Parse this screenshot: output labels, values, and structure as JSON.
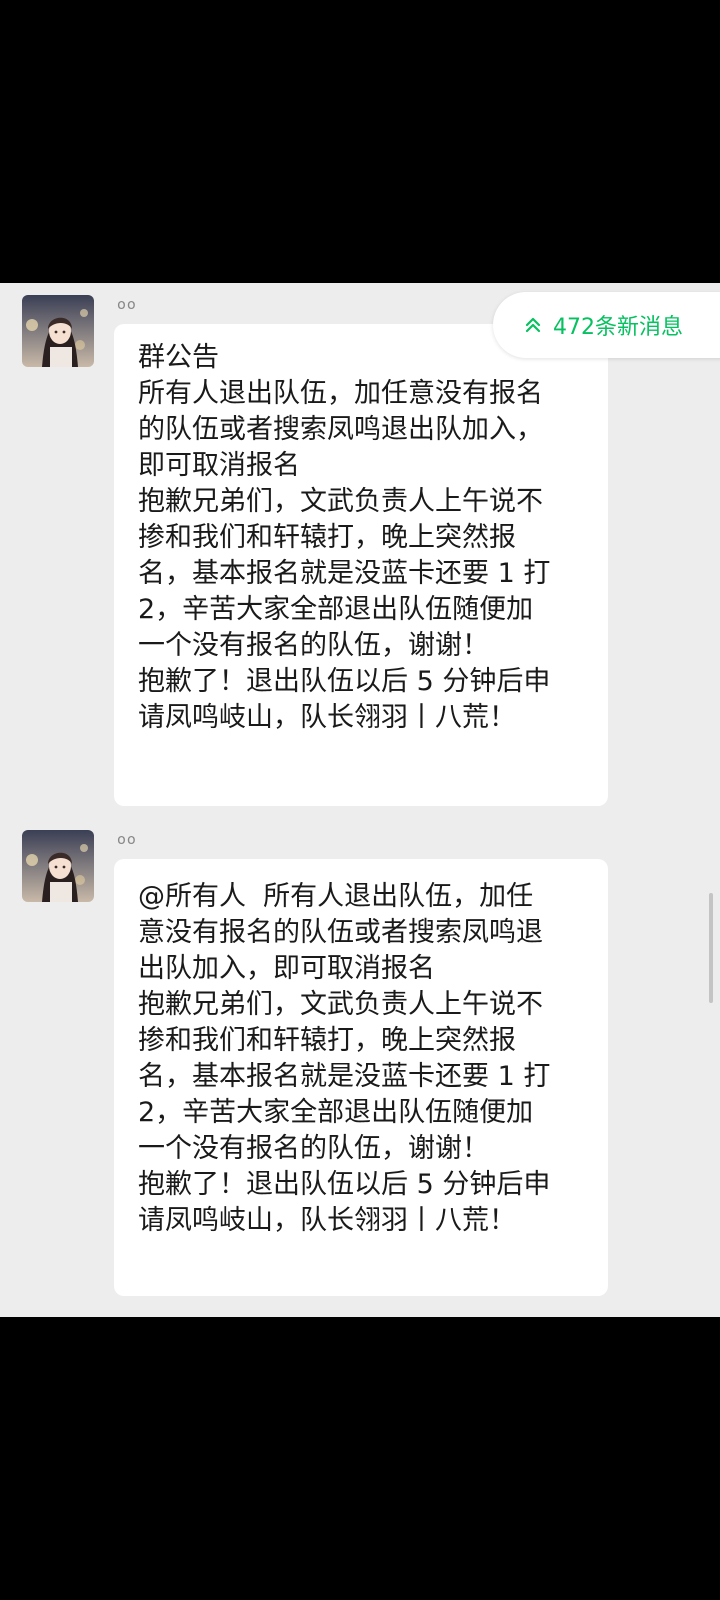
{
  "chat": {
    "new_messages_label": "472条新消息",
    "messages": [
      {
        "sender": "໐໐",
        "lines": [
          "群公告",
          "所有人退出队伍，加任意没有报名",
          "的队伍或者搜索凤鸣退出队加入，",
          "即可取消报名",
          "抱歉兄弟们，文武负责人上午说不",
          "掺和我们和轩辕打，晚上突然报",
          "名，基本报名就是没蓝卡还要 1 打",
          "2，辛苦大家全部退出队伍随便加",
          "一个没有报名的队伍，谢谢！",
          "抱歉了！退出队伍以后 5 分钟后申",
          "请凤鸣岐山，队长翎羽丨八荒！"
        ]
      },
      {
        "sender": "໐໐",
        "lines": [
          "@所有人  所有人退出队伍，加任",
          "意没有报名的队伍或者搜索凤鸣退",
          "出队加入，即可取消报名",
          "抱歉兄弟们，文武负责人上午说不",
          "掺和我们和轩辕打，晚上突然报",
          "名，基本报名就是没蓝卡还要 1 打",
          "2，辛苦大家全部退出队伍随便加",
          "一个没有报名的队伍，谢谢！",
          "抱歉了！退出队伍以后 5 分钟后申",
          "请凤鸣岐山，队长翎羽丨八荒！"
        ]
      }
    ]
  },
  "colors": {
    "accent": "#07c160",
    "chat_background": "#ededed",
    "bubble": "#ffffff",
    "letterbox": "#000000"
  },
  "icons": {
    "avatar": "avatar-anime-girl",
    "new_messages": "double-chevron-up-icon"
  }
}
